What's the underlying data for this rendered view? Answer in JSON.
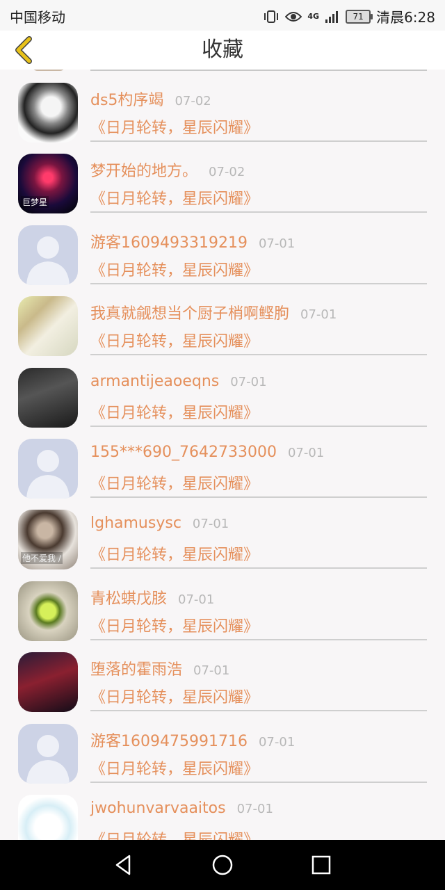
{
  "status_bar": {
    "carrier": "中国移动",
    "network": "4G",
    "battery": "71",
    "time": "清晨6:28"
  },
  "header": {
    "title": "收藏",
    "back_icon": "chevron-left-icon"
  },
  "items": [
    {
      "name": "ds5杓序竭",
      "date": "07-02",
      "book": "《日月轮转，星辰闪耀》",
      "avatar": "photo-avatar"
    },
    {
      "name": "梦开始的地方。",
      "date": "07-02",
      "book": "《日月轮转，星辰闪耀》",
      "avatar": "photo-avatar",
      "avatar_text": "巨梦星"
    },
    {
      "name": "游客1609493319219",
      "date": "07-01",
      "book": "《日月轮转，星辰闪耀》",
      "avatar": "default-user-avatar"
    },
    {
      "name": "我真就觎想当个厨子梢啊鲣朐",
      "date": "07-01",
      "book": "《日月轮转，星辰闪耀》",
      "avatar": "photo-avatar"
    },
    {
      "name": "armantijeaoeqns",
      "date": "07-01",
      "book": "《日月轮转，星辰闪耀》",
      "avatar": "photo-avatar"
    },
    {
      "name": "155***690_7642733000",
      "date": "07-01",
      "book": "《日月轮转，星辰闪耀》",
      "avatar": "default-user-avatar"
    },
    {
      "name": "lghamusysc",
      "date": "07-01",
      "book": "《日月轮转，星辰闪耀》",
      "avatar": "photo-avatar",
      "avatar_text": "他不爱我 ∕"
    },
    {
      "name": "青松蜞戊胲",
      "date": "07-01",
      "book": "《日月轮转，星辰闪耀》",
      "avatar": "photo-avatar"
    },
    {
      "name": "堕落的霍雨浩",
      "date": "07-01",
      "book": "《日月轮转，星辰闪耀》",
      "avatar": "photo-avatar"
    },
    {
      "name": "游客1609475991716",
      "date": "07-01",
      "book": "《日月轮转，星辰闪耀》",
      "avatar": "default-user-avatar"
    },
    {
      "name": "jwohunvarvaaitos",
      "date": "07-01",
      "book": "《日月轮转，星辰闪耀》",
      "avatar": "photo-avatar"
    }
  ],
  "nav_bar": {
    "back": "triangle-back-icon",
    "home": "circle-home-icon",
    "recents": "square-recents-icon"
  },
  "colors": {
    "accent": "#e5905c",
    "date": "#b8b8b8",
    "back_chevron": "#e8c21a"
  }
}
